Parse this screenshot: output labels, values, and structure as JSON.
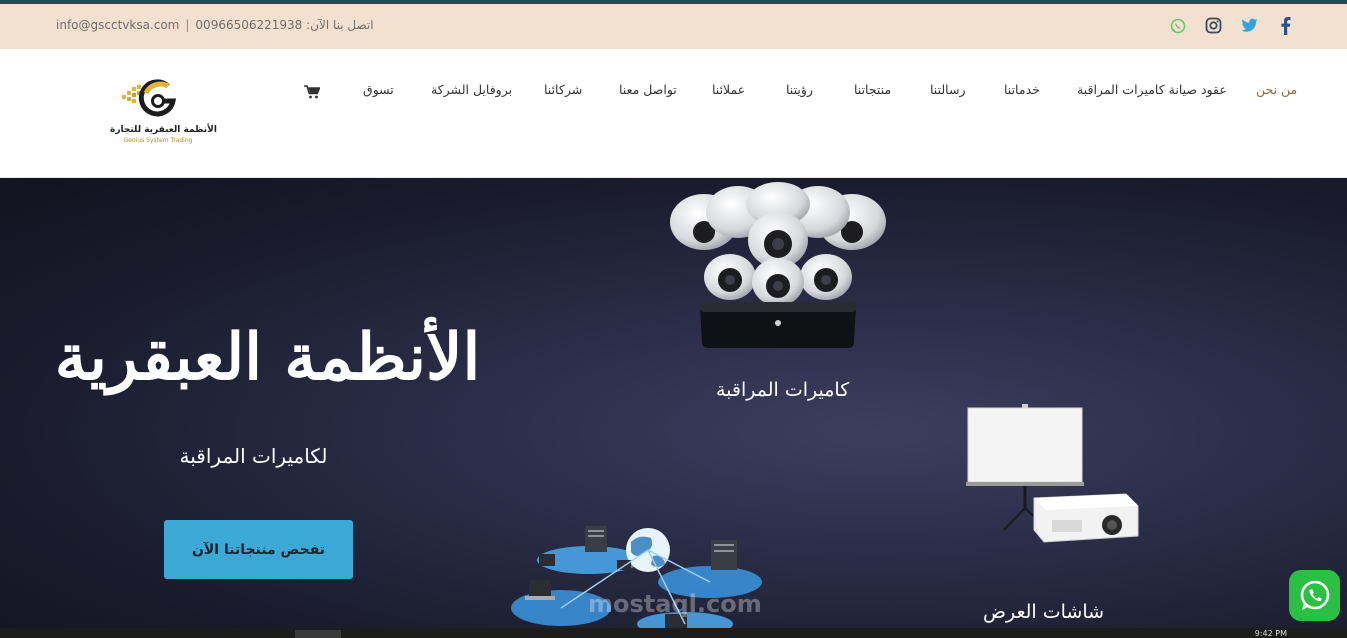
{
  "topbar": {
    "email": "info@gscctvksa.com",
    "separator": "|",
    "phone_text": "اتصل بنا الآن: 00966506221938",
    "social": [
      "facebook-icon",
      "twitter-icon",
      "instagram-icon",
      "whatsapp-icon"
    ]
  },
  "logo": {
    "name": "الأنظمة العبقرية للتجارة",
    "subtitle": "Genius System Trading"
  },
  "nav": {
    "items": [
      "من نحن",
      "عقود صيانة كاميرات المراقبة",
      "خدماتنا",
      "رسالتنا",
      "منتجاتنا",
      "رؤيتنا",
      "عملائنا",
      "تواصل معنا",
      "شركائنا",
      "بروفايل الشركة",
      "تسوق"
    ]
  },
  "hero": {
    "title": "الأنظمة العبقرية",
    "subtitle": "لكاميرات المراقبة",
    "cta": "تفحص منتجاتنا الآن",
    "caption_cameras": "كاميرات المراقبة",
    "caption_screens": "شاشات العرض",
    "watermark": "mostaql.com"
  },
  "taskbar": {
    "clock": "9:42 PM"
  },
  "colors": {
    "accent_blue": "#3aa9d6",
    "topbar_bg": "#f3e1cf",
    "nav_active": "#8a6b43",
    "whatsapp": "#29c043"
  }
}
